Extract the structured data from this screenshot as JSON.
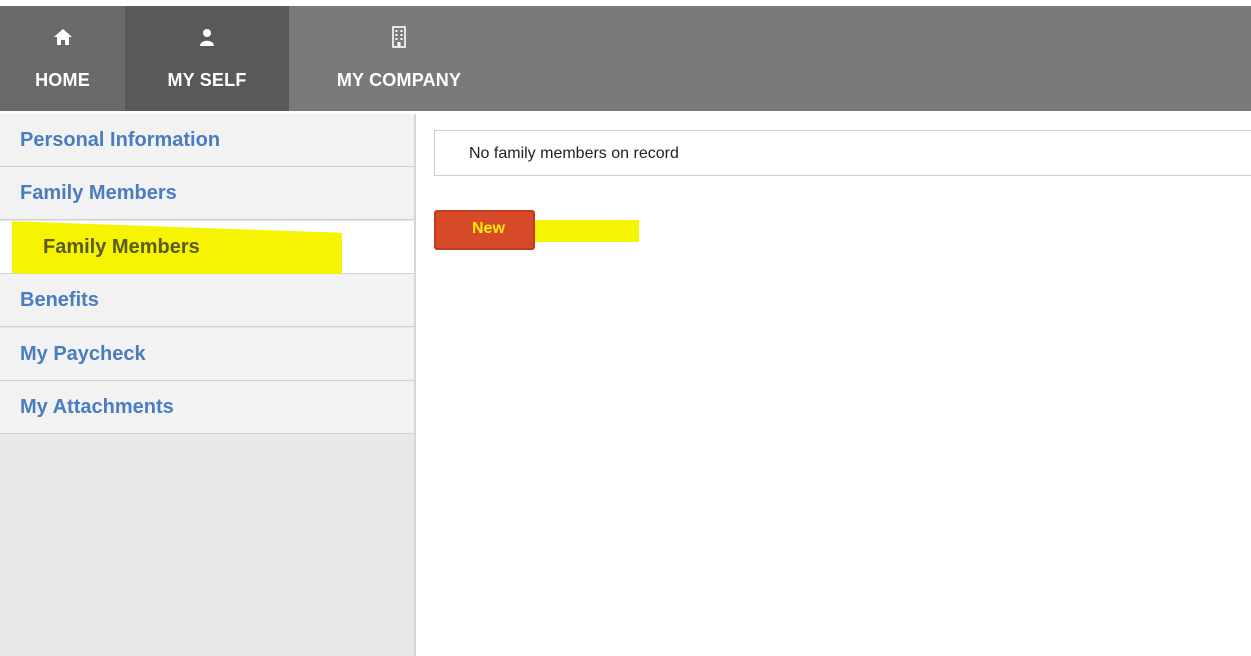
{
  "topnav": {
    "tabs": [
      {
        "label": "HOME",
        "icon": "home-icon"
      },
      {
        "label": "MY SELF",
        "icon": "user-icon"
      },
      {
        "label": "MY COMPANY",
        "icon": "building-icon"
      }
    ],
    "active_tab": "MY SELF"
  },
  "sidebar": {
    "items": [
      {
        "label": "Personal Information"
      },
      {
        "label": "Family Members"
      },
      {
        "label": "Family Members",
        "type": "subitem",
        "highlighted": true
      },
      {
        "label": "Benefits"
      },
      {
        "label": "My Paycheck"
      },
      {
        "label": "My Attachments"
      }
    ]
  },
  "main": {
    "empty_message": "No family members on record",
    "new_button_label": "New"
  },
  "colors": {
    "nav_bg": "#7a7a7a",
    "nav_active": "#595959",
    "link_blue": "#4a7cc1",
    "highlight_yellow": "#f6f400",
    "button_red": "#d64a2a"
  }
}
